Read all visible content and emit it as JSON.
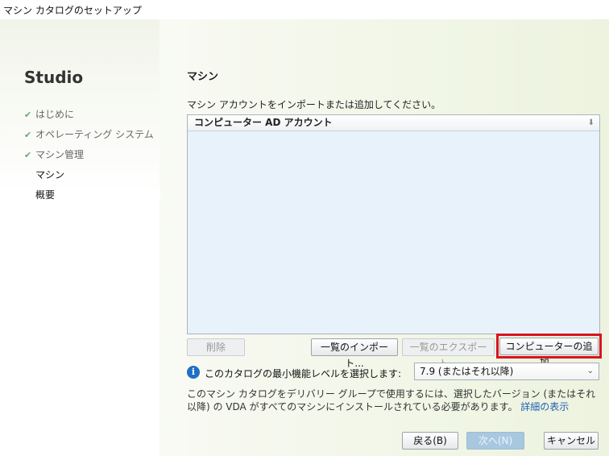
{
  "window": {
    "title": "マシン カタログのセットアップ"
  },
  "sidebar": {
    "brand": "Studio",
    "items": [
      {
        "label": "はじめに",
        "state": "done"
      },
      {
        "label": "オペレーティング システム",
        "state": "done"
      },
      {
        "label": "マシン管理",
        "state": "done"
      },
      {
        "label": "マシン",
        "state": "current"
      },
      {
        "label": "概要",
        "state": "pending"
      }
    ],
    "check_icon": "✔"
  },
  "main": {
    "title": "マシン",
    "instruction": "マシン アカウントをインポートまたは追加してください。",
    "list": {
      "column_header": "コンピューター AD アカウント",
      "sort_icon": "sort-arrow-icon",
      "rows": []
    },
    "buttons": {
      "delete": "削除",
      "import": "一覧のインポート...",
      "export": "一覧のエクスポート...",
      "add_computer": "コンピューターの追加..."
    },
    "functional_level": {
      "label": "このカタログの最小機能レベルを選択します:",
      "selected": "7.9 (またはそれ以降)"
    },
    "note": {
      "text": "このマシン カタログをデリバリー グループで使用するには、選択したバージョン (またはそれ以降) の VDA がすべてのマシンにインストールされている必要があります。",
      "link": "詳細の表示"
    }
  },
  "footer": {
    "back": "戻る(B)",
    "next": "次へ(N)",
    "cancel": "キャンセル"
  },
  "colors": {
    "highlight": "#d8141e",
    "link": "#1f5fb0",
    "info_icon": "#1f6fc5",
    "list_bg": "#e8f2fb"
  }
}
